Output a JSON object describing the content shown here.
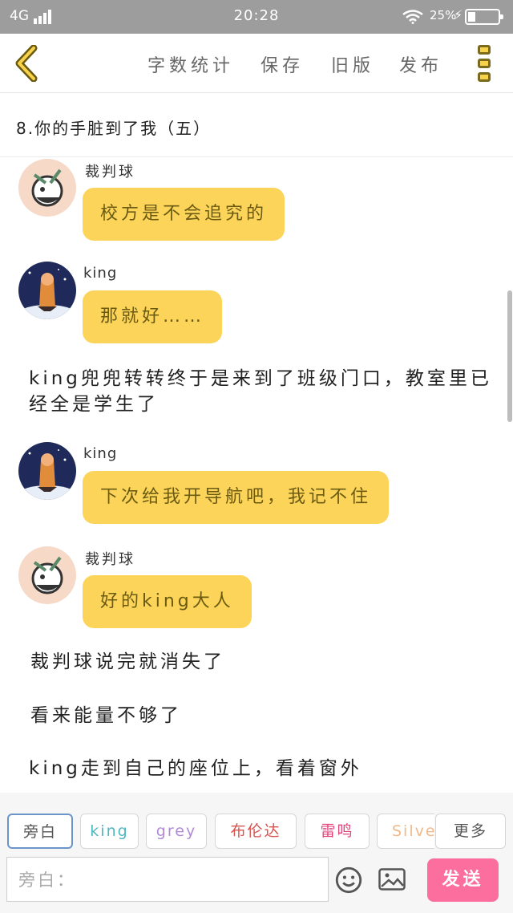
{
  "status_bar": {
    "network": "4G",
    "time": "20:28",
    "battery": "25%",
    "battery_level_percent": 25
  },
  "toolbar": {
    "items": [
      "字数统计",
      "保存",
      "旧版",
      "发布"
    ]
  },
  "chapter": {
    "title": "8.你的手脏到了我（五）"
  },
  "messages": [
    {
      "type": "dialogue",
      "speaker": "裁判球",
      "avatar": "referee-avatar-icon",
      "text": "校方是不会追究的"
    },
    {
      "type": "dialogue",
      "speaker": "king",
      "avatar": "king-avatar-icon",
      "text": "那就好……"
    },
    {
      "type": "narration",
      "text": "king兜兜转转终于是来到了班级门口，教室里已经全是学生了"
    },
    {
      "type": "dialogue",
      "speaker": "king",
      "avatar": "king-avatar-icon",
      "text": "下次给我开导航吧，我记不住"
    },
    {
      "type": "dialogue",
      "speaker": "裁判球",
      "avatar": "referee-avatar-icon",
      "text": "好的king大人"
    },
    {
      "type": "narration",
      "text": "裁判球说完就消失了"
    },
    {
      "type": "narration",
      "text": "看来能量不够了"
    },
    {
      "type": "narration",
      "text": "king走到自己的座位上，看着窗外"
    }
  ],
  "roles": [
    {
      "label": "旁白",
      "color": "#555555"
    },
    {
      "label": "king",
      "color": "#4fb7c2"
    },
    {
      "label": "grey",
      "color": "#b08ad6"
    },
    {
      "label": "布伦达",
      "color": "#d9534f"
    },
    {
      "label": "雷鸣",
      "color": "#e0457b"
    },
    {
      "label": "Silver",
      "color": "#f0b98a"
    }
  ],
  "more_label": "更多",
  "input": {
    "placeholder": "旁白："
  },
  "send_label": "发送",
  "colors": {
    "bubble": "#fcd459",
    "send": "#fb6e9e",
    "status_bar": "#9d9d9d"
  }
}
